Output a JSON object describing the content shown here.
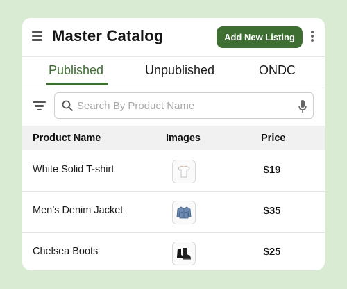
{
  "header": {
    "title": "Master Catalog",
    "add_button_label": "Add New Listing",
    "menu_icon": "hamburger-menu-icon",
    "more_icon": "kebab-menu-icon"
  },
  "tabs": [
    {
      "label": "Published",
      "active": true
    },
    {
      "label": "Unpublished",
      "active": false
    },
    {
      "label": "ONDC",
      "active": false
    }
  ],
  "search": {
    "placeholder": "Search By Product Name",
    "value": "",
    "filter_icon": "filter-icon",
    "search_icon": "search-icon",
    "mic_icon": "microphone-icon"
  },
  "table": {
    "columns": [
      "Product Name",
      "Images",
      "Price"
    ],
    "rows": [
      {
        "name": "White Solid T-shirt",
        "image": "white-tshirt-image",
        "price": "$19"
      },
      {
        "name": "Men’s Denim Jacket",
        "image": "denim-jacket-image",
        "price": "$35"
      },
      {
        "name": "Chelsea Boots",
        "image": "chelsea-boots-image",
        "price": "$25"
      }
    ]
  },
  "colors": {
    "background": "#d9ebd3",
    "accent": "#3f6e33",
    "card": "#ffffff",
    "table_header": "#f1f1f1"
  }
}
